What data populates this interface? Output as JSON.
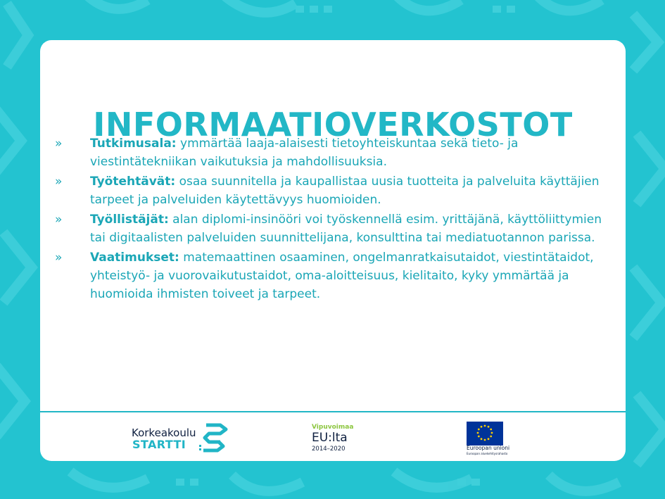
{
  "title": "INFORMAATIOVERKOSTOT",
  "bullet_glyph": "»",
  "items": [
    {
      "term": "Tutkimusala:",
      "text": " ymmärtää laaja-alaisesti tietoyhteiskuntaa sekä tieto- ja viestintätekniikan vaikutuksia ja mahdollisuuksia."
    },
    {
      "term": "Työtehtävät:",
      "text": " osaa suunnitella ja kaupallistaa uusia tuotteita ja palveluita käyttäjien tarpeet ja palveluiden käytettävyys huomioiden."
    },
    {
      "term": "Työllistäjät:",
      "text": " alan diplomi-insinööri voi työskennellä esim. yrittäjänä, käyttöliittymien tai digitaalisten palveluiden suunnittelijana, konsulttina tai mediatuotannon parissa."
    },
    {
      "term": "Vaatimukset:",
      "text": " matemaattinen osaaminen, ongelmanratkaisutaidot, viestintätaidot, yhteistyö- ja vuorovaikutustaidot, oma-aloitteisuus, kielitaito, kyky ymmärtää ja huomioida ihmisten toiveet ja tarpeet."
    }
  ],
  "footer": {
    "korkeakoulu": {
      "line1": "Korkeakoulu",
      "line2": "STARTTI",
      "icon": "startti-s-icon"
    },
    "vipuvoimaa": {
      "line1": "Vipuvoimaa",
      "line2": "EU:lta",
      "line3": "2014–2020"
    },
    "eu": {
      "line1": "Euroopan unioni",
      "line2": "Euroopan aluekehitysrahasto",
      "icon": "eu-flag-icon"
    }
  },
  "colors": {
    "background": "#23c3d0",
    "accent": "#22b7c6",
    "text": "#1aa6b6",
    "dark": "#0f2040",
    "green": "#8cc63f",
    "eu_blue": "#003399",
    "eu_yellow": "#ffcc00"
  }
}
